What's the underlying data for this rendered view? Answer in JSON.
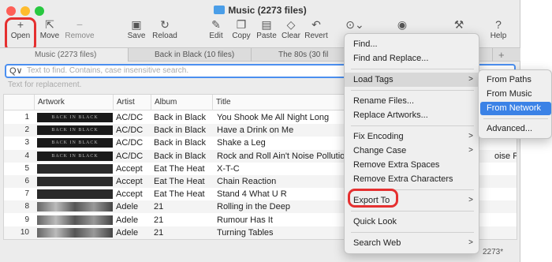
{
  "window": {
    "title": "Music (2273 files)"
  },
  "toolbar": {
    "open": "Open",
    "move": "Move",
    "remove": "Remove",
    "save": "Save",
    "reload": "Reload",
    "edit": "Edit",
    "copy": "Copy",
    "paste": "Paste",
    "clear": "Clear",
    "revert": "Revert",
    "help": "Help"
  },
  "tabs": [
    {
      "label": "Music (2273 files)"
    },
    {
      "label": "Back in Black (10 files)"
    },
    {
      "label": "The 80s (30 fil"
    }
  ],
  "tab_add": "+",
  "find": {
    "prefix": "Q∨",
    "placeholder": "Text to find. Contains, case insensitive search."
  },
  "replace": {
    "placeholder": "Text for replacement."
  },
  "columns": [
    "Artwork",
    "Artist",
    "Album",
    "Title"
  ],
  "rows": [
    {
      "n": "1",
      "art": "BACK IN BLACK",
      "artist": "AC/DC",
      "album": "Back in Black",
      "title": "You Shook Me All Night Long",
      "extra": ""
    },
    {
      "n": "2",
      "art": "BACK IN BLACK",
      "artist": "AC/DC",
      "album": "Back in Black",
      "title": "Have a Drink on Me",
      "extra": ""
    },
    {
      "n": "3",
      "art": "BACK IN BLACK",
      "artist": "AC/DC",
      "album": "Back in Black",
      "title": "Shake a Leg",
      "extra": ""
    },
    {
      "n": "4",
      "art": "BACK IN BLACK",
      "artist": "AC/DC",
      "album": "Back in Black",
      "title": "Rock and Roll Ain't Noise Pollution",
      "extra": "oise Pol"
    },
    {
      "n": "5",
      "art": "",
      "artist": "Accept",
      "album": "Eat The Heat",
      "title": "X-T-C",
      "extra": ""
    },
    {
      "n": "6",
      "art": "",
      "artist": "Accept",
      "album": "Eat The Heat",
      "title": "Chain Reaction",
      "extra": ""
    },
    {
      "n": "7",
      "art": "",
      "artist": "Accept",
      "album": "Eat The Heat",
      "title": "Stand 4 What U R",
      "extra": ""
    },
    {
      "n": "8",
      "art": "",
      "artist": "Adele",
      "album": "21",
      "title": "Rolling in the Deep",
      "extra": ""
    },
    {
      "n": "9",
      "art": "",
      "artist": "Adele",
      "album": "21",
      "title": "Rumour Has It",
      "extra": ""
    },
    {
      "n": "10",
      "art": "",
      "artist": "Adele",
      "album": "21",
      "title": "Turning Tables",
      "extra": ""
    }
  ],
  "status": "2273*",
  "menu": {
    "items": [
      "Find...",
      "Find and Replace...",
      "Load Tags",
      "Rename Files...",
      "Replace Artworks...",
      "Fix Encoding",
      "Change Case",
      "Remove Extra Spaces",
      "Remove Extra Characters",
      "Export To",
      "Quick Look",
      "Search Web"
    ],
    "arrow": ">"
  },
  "submenu": {
    "items": [
      "From Paths",
      "From Music",
      "From Network",
      "Advanced..."
    ]
  },
  "colors": {
    "highlight": "#e53030",
    "selection": "#3b82e6",
    "focus": "#4b8ff0"
  }
}
